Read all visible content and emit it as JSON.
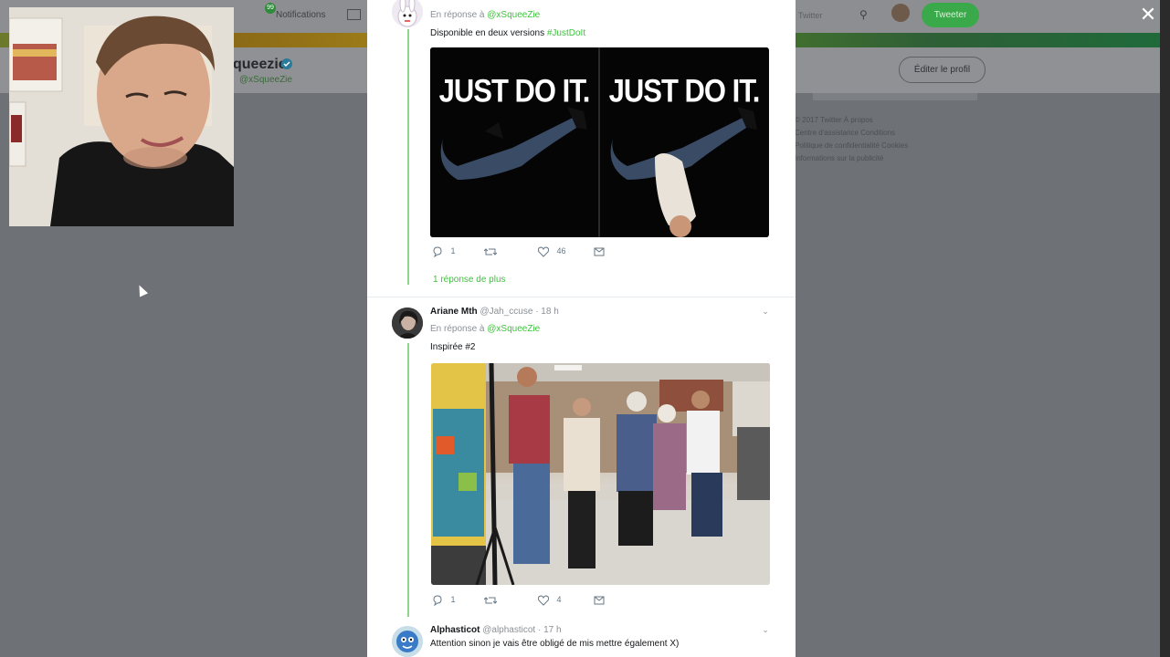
{
  "background": {
    "notifications_label": "Notifications",
    "notifications_count": "99",
    "tweeter_label": "Tweeter",
    "profile_name": "queezie",
    "profile_handle": "@xSqueeZie",
    "edit_profile_label": "Éditer le profil",
    "twitter_label": "Twitter",
    "footer_lines": [
      "© 2017 Twitter   À propos",
      "Centre d'assistance   Conditions",
      "Politique de confidentialité   Cookies",
      "Informations sur la publicité"
    ]
  },
  "modal": {
    "tweet1": {
      "reply_prefix": "En réponse à",
      "reply_mention": "@xSqueeZie",
      "text": "Disponible en deux versions",
      "hashtag": "#JustDoIt",
      "image_text_left": "JUST DO IT.",
      "image_text_right": "JUST DO IT.",
      "replies": "1",
      "retweets": "",
      "likes": "46",
      "more_replies": "1 réponse de plus"
    },
    "tweet2": {
      "name": "Ariane Mth",
      "handle": "@Jah_ccuse",
      "time": "· 18 h",
      "reply_prefix": "En réponse à",
      "reply_mention": "@xSqueeZie",
      "text": "Inspirée #2",
      "replies": "1",
      "retweets": "",
      "likes": "4"
    },
    "tweet3": {
      "name": "Alphasticot",
      "handle": "@alphasticot",
      "time": "· 17 h",
      "text": "Attention sinon je vais être obligé de mis mettre également X)"
    }
  },
  "close_label": "✕",
  "colors": {
    "accent": "#3ec23e",
    "overlay": "#6e7175"
  }
}
